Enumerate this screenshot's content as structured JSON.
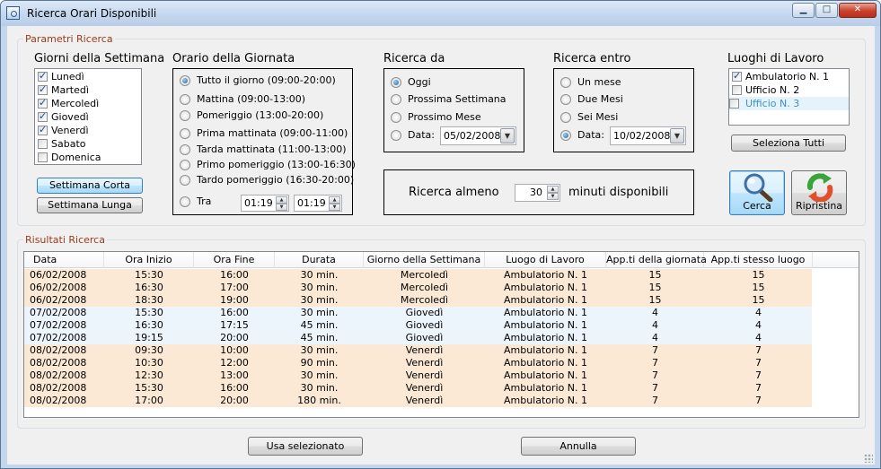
{
  "window": {
    "title": "Ricerca Orari Disponibili",
    "controls": {
      "minimize": "▁",
      "maximize": "□",
      "close": "✕"
    }
  },
  "params": {
    "group_label": "Parametri Ricerca",
    "days": {
      "label": "Giorni della Settimana",
      "items": [
        {
          "label": "Lunedì",
          "checked": true
        },
        {
          "label": "Martedì",
          "checked": true
        },
        {
          "label": "Mercoledì",
          "checked": true
        },
        {
          "label": "Giovedì",
          "checked": true
        },
        {
          "label": "Venerdì",
          "checked": true
        },
        {
          "label": "Sabato",
          "checked": false
        },
        {
          "label": "Domenica",
          "checked": false
        }
      ],
      "btn_short": "Settimana Corta",
      "btn_long": "Settimana Lunga"
    },
    "hours": {
      "label": "Orario della Giornata",
      "options": [
        {
          "label": "Tutto il giorno (09:00-20:00)",
          "selected": true
        },
        {
          "label": "Mattina (09:00-13:00)",
          "selected": false
        },
        {
          "label": "Pomeriggio (13:00-20:00)",
          "selected": false
        },
        {
          "label": "Prima mattinata (09:00-11:00)",
          "selected": false
        },
        {
          "label": "Tarda mattinata (11:00-13:00)",
          "selected": false
        },
        {
          "label": "Primo pomeriggio (13:00-16:30)",
          "selected": false
        },
        {
          "label": "Tardo pomeriggio (16:30-20:00)",
          "selected": false
        },
        {
          "label": "Tra",
          "selected": false
        }
      ],
      "between_from": "01:19",
      "between_to": "01:19"
    },
    "search_from": {
      "label": "Ricerca da",
      "options": [
        {
          "label": "Oggi",
          "selected": true
        },
        {
          "label": "Prossima Settimana",
          "selected": false
        },
        {
          "label": "Prossimo Mese",
          "selected": false
        },
        {
          "label": "Data:",
          "selected": false
        }
      ],
      "date": "05/02/2008"
    },
    "search_within": {
      "label": "Ricerca entro",
      "options": [
        {
          "label": "Un mese",
          "selected": false
        },
        {
          "label": "Due Mesi",
          "selected": false
        },
        {
          "label": "Sei Mesi",
          "selected": false
        },
        {
          "label": "Data:",
          "selected": true
        }
      ],
      "date": "10/02/2008"
    },
    "workplaces": {
      "label": "Luoghi di Lavoro",
      "items": [
        {
          "label": "Ambulatorio N. 1",
          "checked": true,
          "highlight": false
        },
        {
          "label": "Ufficio N. 2",
          "checked": false,
          "highlight": false
        },
        {
          "label": "Ufficio N. 3",
          "checked": false,
          "highlight": true
        }
      ],
      "btn_select_all": "Seleziona Tutti"
    },
    "min_available": {
      "prefix": "Ricerca almeno",
      "value": "30",
      "suffix": "minuti disponibili"
    },
    "btn_search": "Cerca",
    "btn_reset": "Ripristina"
  },
  "results": {
    "group_label": "Risultati Ricerca",
    "columns": [
      "Data",
      "Ora Inizio",
      "Ora Fine",
      "Durata",
      "Giorno della Settimana",
      "Luogo di Lavoro",
      "App.ti della giornata",
      "App.ti stesso luogo"
    ],
    "rows": [
      {
        "cells": [
          "06/02/2008",
          "15:30",
          "16:00",
          "30 min.",
          "Mercoledì",
          "Ambulatorio N. 1",
          "15",
          "15"
        ],
        "color": "#fbe9d5"
      },
      {
        "cells": [
          "06/02/2008",
          "16:30",
          "17:00",
          "30 min.",
          "Mercoledì",
          "Ambulatorio N. 1",
          "15",
          "15"
        ],
        "color": "#fbe9d5"
      },
      {
        "cells": [
          "06/02/2008",
          "18:30",
          "19:00",
          "30 min.",
          "Mercoledì",
          "Ambulatorio N. 1",
          "15",
          "15"
        ],
        "color": "#fbe9d5"
      },
      {
        "cells": [
          "07/02/2008",
          "15:30",
          "16:00",
          "30 min.",
          "Giovedì",
          "Ambulatorio N. 1",
          "4",
          "4"
        ],
        "color": "#edf5fc"
      },
      {
        "cells": [
          "07/02/2008",
          "16:30",
          "17:15",
          "45 min.",
          "Giovedì",
          "Ambulatorio N. 1",
          "4",
          "4"
        ],
        "color": "#edf5fc"
      },
      {
        "cells": [
          "07/02/2008",
          "19:15",
          "20:00",
          "45 min.",
          "Giovedì",
          "Ambulatorio N. 1",
          "4",
          "4"
        ],
        "color": "#edf5fc"
      },
      {
        "cells": [
          "08/02/2008",
          "09:30",
          "10:00",
          "30 min.",
          "Venerdì",
          "Ambulatorio N. 1",
          "7",
          "7"
        ],
        "color": "#fbe9d5"
      },
      {
        "cells": [
          "08/02/2008",
          "10:30",
          "12:00",
          "90 min.",
          "Venerdì",
          "Ambulatorio N. 1",
          "7",
          "7"
        ],
        "color": "#fbe9d5"
      },
      {
        "cells": [
          "08/02/2008",
          "12:30",
          "13:00",
          "30 min.",
          "Venerdì",
          "Ambulatorio N. 1",
          "7",
          "7"
        ],
        "color": "#fbe9d5"
      },
      {
        "cells": [
          "08/02/2008",
          "15:30",
          "16:00",
          "30 min.",
          "Venerdì",
          "Ambulatorio N. 1",
          "7",
          "7"
        ],
        "color": "#fbe9d5"
      },
      {
        "cells": [
          "08/02/2008",
          "17:00",
          "20:00",
          "180 min.",
          "Venerdì",
          "Ambulatorio N. 1",
          "7",
          "7"
        ],
        "color": "#fbe9d5"
      }
    ]
  },
  "footer": {
    "btn_use": "Usa selezionato",
    "btn_cancel": "Annulla"
  }
}
